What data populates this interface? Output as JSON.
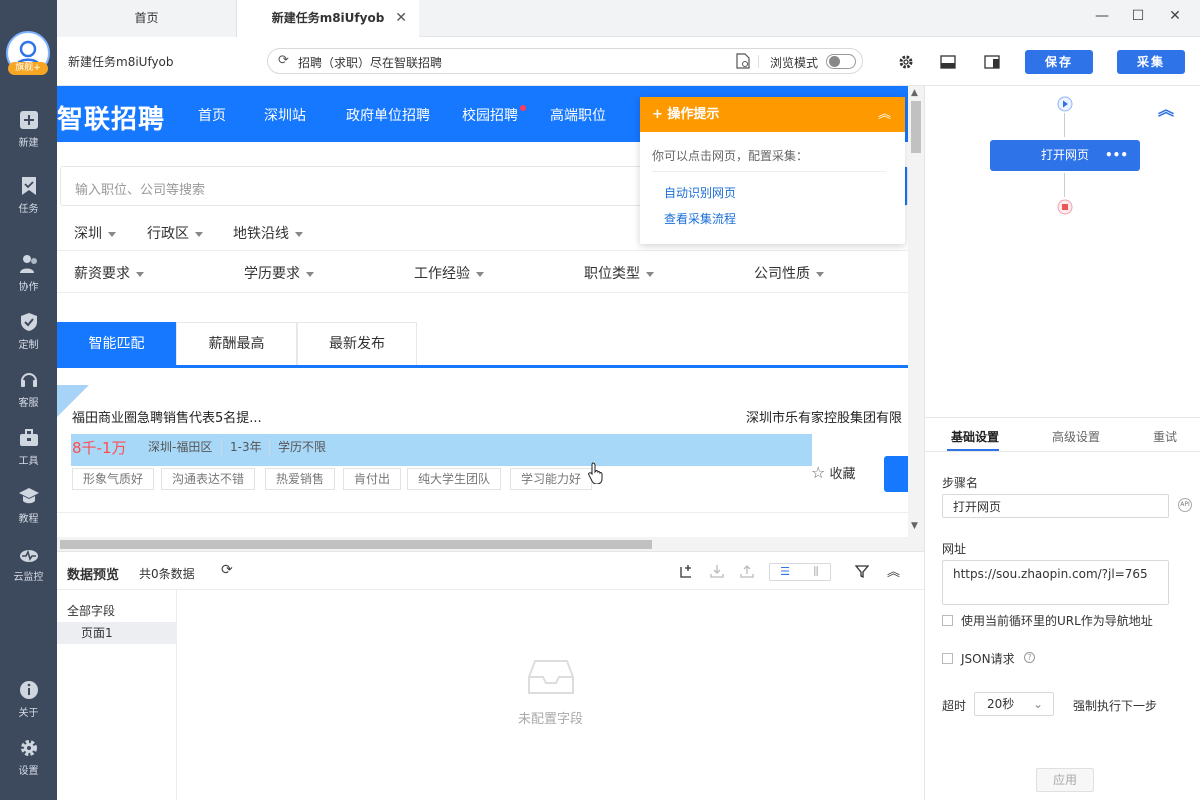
{
  "sidebar": {
    "avatar_badge": "旗舰+",
    "items": [
      {
        "label": "新建",
        "icon": "plus-icon"
      },
      {
        "label": "任务",
        "icon": "bookmark-icon"
      },
      {
        "label": "协作",
        "icon": "users-icon"
      },
      {
        "label": "定制",
        "icon": "shield-check-icon"
      },
      {
        "label": "客服",
        "icon": "headset-icon"
      },
      {
        "label": "工具",
        "icon": "toolbox-icon"
      },
      {
        "label": "教程",
        "icon": "graduation-cap-icon"
      },
      {
        "label": "云监控",
        "icon": "pulse-icon"
      },
      {
        "label": "关于",
        "icon": "info-icon"
      },
      {
        "label": "设置",
        "icon": "gear-icon"
      }
    ]
  },
  "tabs": {
    "home": "首页",
    "active": "新建任务m8iUfyob",
    "close": "✕"
  },
  "window": {
    "minimize": "—",
    "maximize": "☐",
    "close": "✕"
  },
  "toolbar": {
    "task_name": "新建任务m8iUfyob",
    "url_text": "招聘（求职）尽在智联招聘",
    "browse_mode": "浏览模式",
    "save_label": "保存",
    "collect_label": "采集"
  },
  "site": {
    "logo": "智联招聘",
    "nav": [
      "首页",
      "深圳站",
      "政府单位招聘",
      "校园招聘",
      "高端职位"
    ],
    "search_placeholder": "输入职位、公司等搜索",
    "filters_row1": [
      "深圳",
      "行政区",
      "地铁沿线"
    ],
    "filters_row2": [
      "薪资要求",
      "学历要求",
      "工作经验",
      "职位类型",
      "公司性质"
    ],
    "job_tabs": [
      "智能匹配",
      "薪酬最高",
      "最新发布"
    ],
    "job": {
      "title": "福田商业圈急聘销售代表5名提...",
      "company": "深圳市乐有家控股集团有限",
      "salary": "8千-1万",
      "meta": [
        "深圳-福田区",
        "1-3年",
        "学历不限"
      ],
      "tags": [
        "形象气质好",
        "沟通表达不错",
        "热爱销售",
        "肯付出",
        "纯大学生团队",
        "学习能力好"
      ],
      "fav": "收藏"
    }
  },
  "popup": {
    "title": "操作提示",
    "desc": "你可以点击网页，配置采集：",
    "links": [
      "自动识别网页",
      "查看采集流程"
    ]
  },
  "data_preview": {
    "title": "数据预览",
    "count": "共0条数据",
    "all_fields": "全部字段",
    "page1": "页面1",
    "empty": "未配置字段"
  },
  "flow": {
    "node_label": "打开网页",
    "node_more": "•••"
  },
  "settings": {
    "tabs": [
      "基础设置",
      "高级设置",
      "重试"
    ],
    "step_name_label": "步骤名",
    "step_name_value": "打开网页",
    "url_label": "网址",
    "url_value": "https://sou.zhaopin.com/?jl=765",
    "loop_url_label": "使用当前循环里的URL作为导航地址",
    "json_label": "JSON请求",
    "timeout_label": "超时",
    "timeout_value": "20秒",
    "force_next": "强制执行下一步",
    "apply": "应用",
    "api_badge": "API"
  },
  "colors": {
    "primary": "#2f73e8",
    "site_blue": "#1677ff",
    "popup_orange": "#ff9900",
    "sidebar": "#3d4a5e"
  }
}
